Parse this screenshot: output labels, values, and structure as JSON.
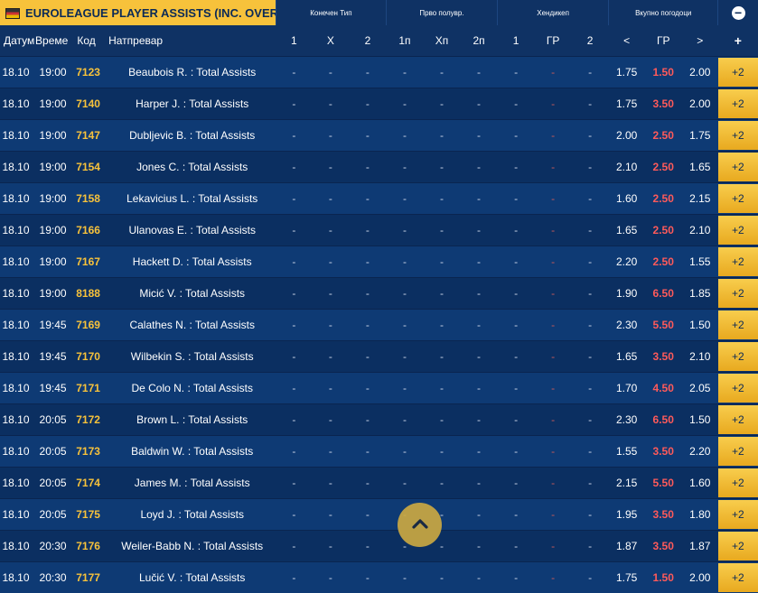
{
  "header": {
    "title": "EUROLEAGUE PLAYER ASSISTS (INC. OVER ...",
    "groups": {
      "final": "Конечен Тип",
      "first_half": "Прво полувр.",
      "handicap": "Хендикеп",
      "total_goals": "Вкупно погодоци"
    },
    "collapse_symbol": "−"
  },
  "columns": {
    "date": "Датум",
    "time": "Време",
    "code": "Код",
    "match": "Натпревар",
    "c1": "1",
    "cx": "X",
    "c2": "2",
    "h1": "1п",
    "hx": "Хп",
    "h2": "2п",
    "hc1": "1",
    "hcgr": "ГР",
    "hc2": "2",
    "under": "<",
    "gr": "ГР",
    "over": ">",
    "plus": "+"
  },
  "empty_odd": "-",
  "rows": [
    {
      "date": "18.10",
      "time": "19:00",
      "code": "7123",
      "match": "Beaubois R. : Total Assists",
      "under": "1.75",
      "gr": "1.50",
      "over": "2.00",
      "more": "+2"
    },
    {
      "date": "18.10",
      "time": "19:00",
      "code": "7140",
      "match": "Harper J. : Total Assists",
      "under": "1.75",
      "gr": "3.50",
      "over": "2.00",
      "more": "+2"
    },
    {
      "date": "18.10",
      "time": "19:00",
      "code": "7147",
      "match": "Dubljevic B. : Total Assists",
      "under": "2.00",
      "gr": "2.50",
      "over": "1.75",
      "more": "+2"
    },
    {
      "date": "18.10",
      "time": "19:00",
      "code": "7154",
      "match": "Jones C. : Total Assists",
      "under": "2.10",
      "gr": "2.50",
      "over": "1.65",
      "more": "+2"
    },
    {
      "date": "18.10",
      "time": "19:00",
      "code": "7158",
      "match": "Lekavicius L. : Total Assists",
      "under": "1.60",
      "gr": "2.50",
      "over": "2.15",
      "more": "+2"
    },
    {
      "date": "18.10",
      "time": "19:00",
      "code": "7166",
      "match": "Ulanovas E. : Total Assists",
      "under": "1.65",
      "gr": "2.50",
      "over": "2.10",
      "more": "+2"
    },
    {
      "date": "18.10",
      "time": "19:00",
      "code": "7167",
      "match": "Hackett D. : Total Assists",
      "under": "2.20",
      "gr": "2.50",
      "over": "1.55",
      "more": "+2"
    },
    {
      "date": "18.10",
      "time": "19:00",
      "code": "8188",
      "match": "Micić V. : Total Assists",
      "under": "1.90",
      "gr": "6.50",
      "over": "1.85",
      "more": "+2"
    },
    {
      "date": "18.10",
      "time": "19:45",
      "code": "7169",
      "match": "Calathes N. : Total Assists",
      "under": "2.30",
      "gr": "5.50",
      "over": "1.50",
      "more": "+2"
    },
    {
      "date": "18.10",
      "time": "19:45",
      "code": "7170",
      "match": "Wilbekin S. : Total Assists",
      "under": "1.65",
      "gr": "3.50",
      "over": "2.10",
      "more": "+2"
    },
    {
      "date": "18.10",
      "time": "19:45",
      "code": "7171",
      "match": "De Colo N. : Total Assists",
      "under": "1.70",
      "gr": "4.50",
      "over": "2.05",
      "more": "+2"
    },
    {
      "date": "18.10",
      "time": "20:05",
      "code": "7172",
      "match": "Brown L. : Total Assists",
      "under": "2.30",
      "gr": "6.50",
      "over": "1.50",
      "more": "+2"
    },
    {
      "date": "18.10",
      "time": "20:05",
      "code": "7173",
      "match": "Baldwin W. : Total Assists",
      "under": "1.55",
      "gr": "3.50",
      "over": "2.20",
      "more": "+2"
    },
    {
      "date": "18.10",
      "time": "20:05",
      "code": "7174",
      "match": "James M. : Total Assists",
      "under": "2.15",
      "gr": "5.50",
      "over": "1.60",
      "more": "+2"
    },
    {
      "date": "18.10",
      "time": "20:05",
      "code": "7175",
      "match": "Loyd J. : Total Assists",
      "under": "1.95",
      "gr": "3.50",
      "over": "1.80",
      "more": "+2"
    },
    {
      "date": "18.10",
      "time": "20:30",
      "code": "7176",
      "match": "Weiler-Babb N. : Total Assists",
      "under": "1.87",
      "gr": "3.50",
      "over": "1.87",
      "more": "+2"
    },
    {
      "date": "18.10",
      "time": "20:30",
      "code": "7177",
      "match": "Lučić V. : Total Assists",
      "under": "1.75",
      "gr": "1.50",
      "over": "2.00",
      "more": "+2"
    }
  ],
  "icons": {
    "league_flag": "flag-icon",
    "collapse": "minus-circle-icon",
    "scroll_top": "chevron-up-icon"
  },
  "colors": {
    "background": "#0b2a57",
    "accent": "#f7c23b",
    "code": "#f7c23b",
    "highlight_odds": "#ff5a5a"
  }
}
